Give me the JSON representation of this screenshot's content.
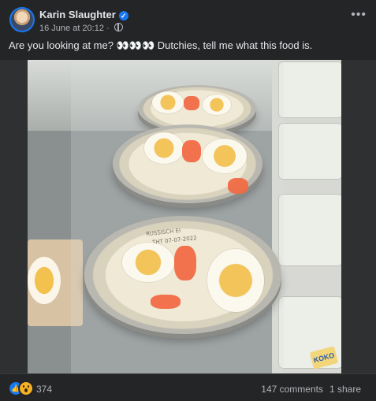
{
  "post": {
    "author": "Karin Slaughter",
    "verified": true,
    "date": "16 June at 20:12",
    "separator": "·",
    "caption": "Are you looking at me? 👀👀👀 Dutchies, tell me what this food is.",
    "more_label": "•••"
  },
  "photo": {
    "tray_label": "RUSSISCH EI",
    "tray_label_2": "THT 07-07-2022",
    "brand_tag": "KOKO"
  },
  "footer": {
    "reaction_count": "374",
    "comments": "147 comments",
    "shares": "1 share"
  },
  "colors": {
    "background": "#242526",
    "accent": "#1877f2",
    "text": "#e4e6eb",
    "secondary_text": "#b0b3b8"
  },
  "icons": {
    "verified": "verified-badge-icon",
    "globe": "globe-icon",
    "more": "more-options-icon",
    "like": "like-reaction-icon",
    "wow": "wow-reaction-icon"
  }
}
